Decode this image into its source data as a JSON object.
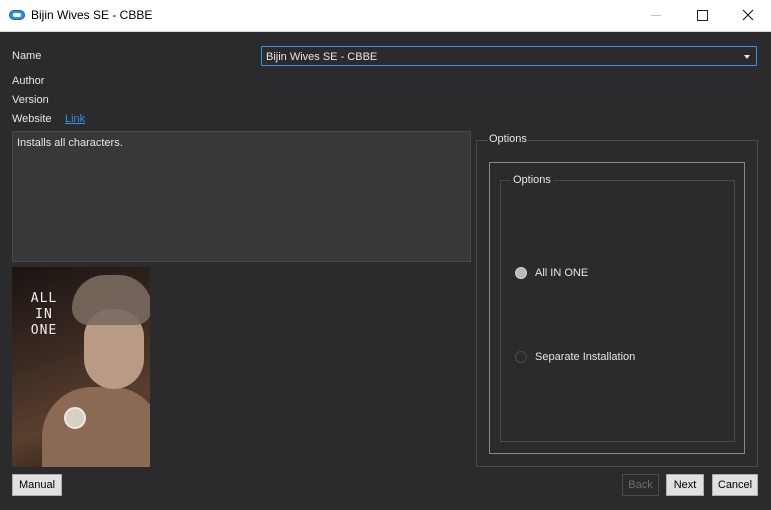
{
  "window": {
    "title": "Bijin Wives SE - CBBE"
  },
  "info": {
    "name_label": "Name",
    "author_label": "Author",
    "version_label": "Version",
    "website_label": "Website",
    "website_link": "Link",
    "name_value": "Bijin Wives SE - CBBE",
    "description": "Installs all characters."
  },
  "preview": {
    "overlay_text": "ALL IN ONE"
  },
  "options": {
    "outer_title": "Options",
    "inner_title": "Options",
    "choices": [
      {
        "label": "All IN ONE",
        "selected": true
      },
      {
        "label": "Separate Installation",
        "selected": false
      }
    ]
  },
  "buttons": {
    "manual": "Manual",
    "back": "Back",
    "next": "Next",
    "cancel": "Cancel"
  },
  "colors": {
    "accent": "#3b8fe8",
    "background": "#2b2b2e"
  }
}
